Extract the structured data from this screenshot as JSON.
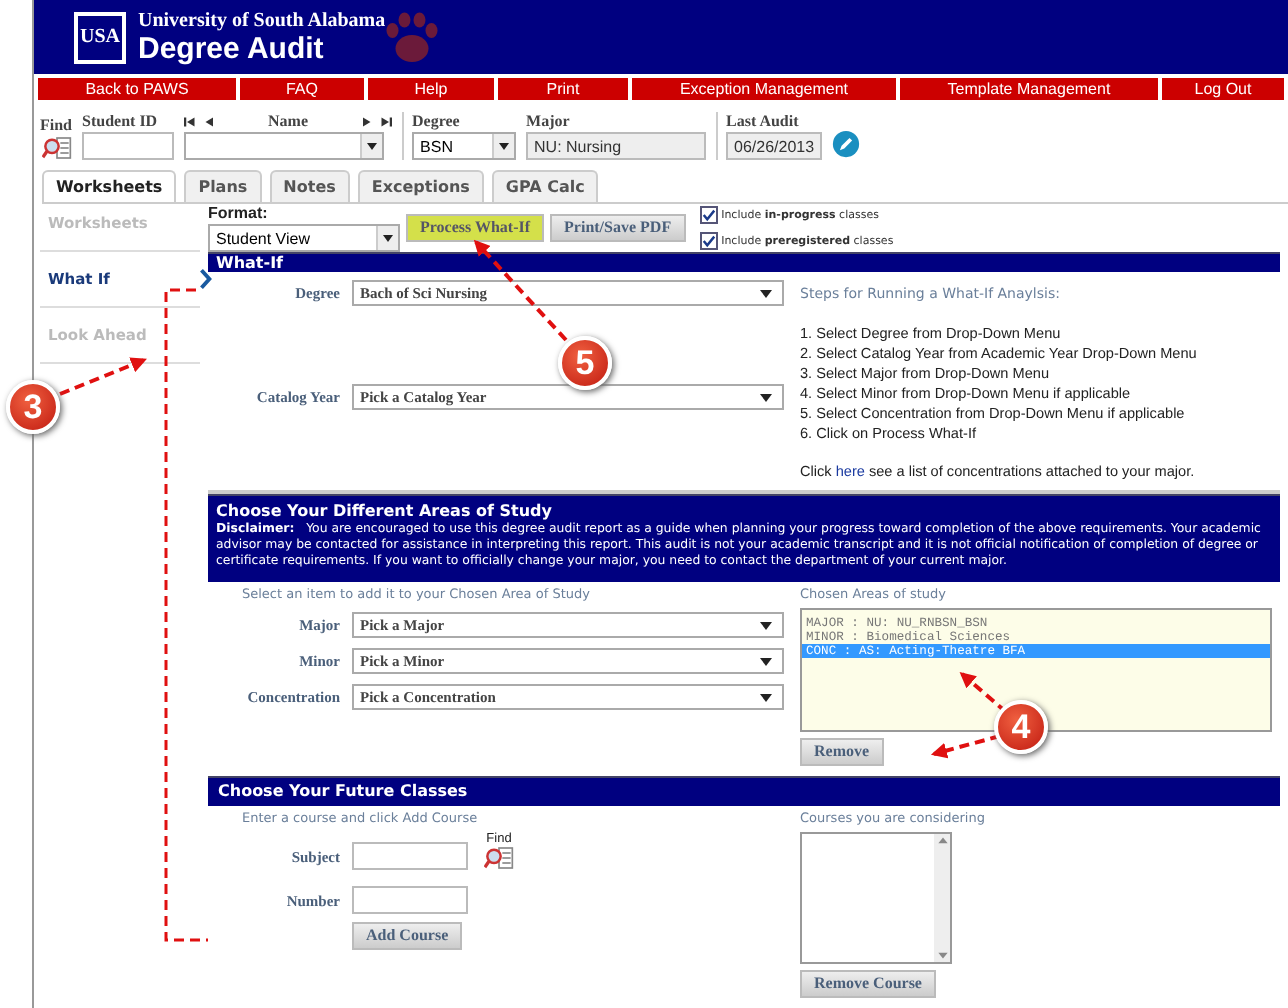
{
  "header": {
    "logo": "USA",
    "university": "University of South Alabama",
    "title": "Degree Audit"
  },
  "menu": [
    "Back to PAWS",
    "FAQ",
    "Help",
    "Print",
    "Exception Management",
    "Template Management",
    "Log Out"
  ],
  "student": {
    "find_label": "Find",
    "id_label": "Student ID",
    "name_label": "Name",
    "degree_label": "Degree",
    "degree": "BSN",
    "major_label": "Major",
    "major": "NU: Nursing",
    "last_audit_label": "Last Audit",
    "last_audit": "06/26/2013"
  },
  "tabs": [
    {
      "label": "Worksheets",
      "selected": true
    },
    {
      "label": "Plans",
      "selected": false
    },
    {
      "label": "Notes",
      "selected": false
    },
    {
      "label": "Exceptions",
      "selected": false
    },
    {
      "label": "GPA Calc",
      "selected": false
    }
  ],
  "sidebar": {
    "items": [
      {
        "label": "Worksheets",
        "selected": false
      },
      {
        "label": "What If",
        "selected": true
      },
      {
        "label": "Look Ahead",
        "selected": false
      }
    ]
  },
  "toolbar": {
    "format_label": "Format:",
    "format": "Student View",
    "process_button": "Process What-If",
    "print_button": "Print/Save PDF",
    "checkboxes": [
      {
        "label": "Include **in-progress** classes",
        "checked": true
      },
      {
        "label": "Include **preregistered** classes",
        "checked": true
      }
    ]
  },
  "what_if": {
    "title": "What-If",
    "fields": [
      {
        "label": "Degree",
        "value": "Bach of Sci Nursing"
      },
      {
        "label": "Catalog Year",
        "value": "Pick a Catalog Year"
      }
    ],
    "steps_title": "Steps for Running a What-If Anaylsis:",
    "steps": [
      "1. Select Degree from Drop-Down Menu",
      "2. Select Catalog Year from Academic Year Drop-Down Menu",
      "3. Select Major from Drop-Down Menu",
      "4. Select Minor from Drop-Down Menu if applicable",
      "5. Select Concentration from Drop-Down Menu if applicable",
      "6. Click on Process What-If"
    ],
    "note_before": "Click",
    "note_link": "here",
    "note_after": "see a list of concentrations attached to your major."
  },
  "areas": {
    "title": "Choose Your Different Areas of Study",
    "disclaimer_label": "Disclaimer:",
    "disclaimer": "You are encouraged to use this degree audit report as a guide when planning your progress toward completion of the above requirements. Your academic advisor may be contacted for assistance in interpreting this report. This audit is not your academic transcript and it is not official notification of completion of degree or certificate requirements. If you want to officially change your major, you need to contact the department of your current major.",
    "hint": "Select an item to add it to your Chosen Area of Study",
    "fields": [
      {
        "label": "Major",
        "value": "Pick a Major"
      },
      {
        "label": "Minor",
        "value": "Pick a Minor"
      },
      {
        "label": "Concentration",
        "value": "Pick a Concentration"
      }
    ],
    "chosen_label": "Chosen Areas of study",
    "chosen": [
      {
        "text": "MAJOR : NU: NU_RNBSN_BSN",
        "selected": false
      },
      {
        "text": "MINOR : Biomedical Sciences",
        "selected": false
      },
      {
        "text": "CONC : AS: Acting-Theatre BFA",
        "selected": true
      }
    ],
    "remove_button": "Remove"
  },
  "future": {
    "title": "Choose Your Future Classes",
    "hint": "Enter a course and click Add Course",
    "subject_label": "Subject",
    "number_label": "Number",
    "find_label": "Find",
    "add_button": "Add Course",
    "considering_label": "Courses you are considering",
    "remove_button": "Remove Course"
  },
  "callouts": [
    {
      "number": "3"
    },
    {
      "number": "5"
    },
    {
      "number": "4"
    }
  ]
}
